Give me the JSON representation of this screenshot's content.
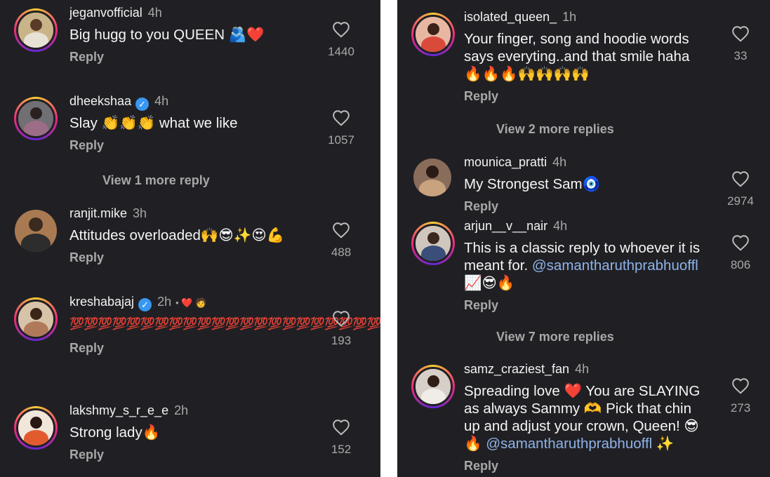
{
  "left": {
    "comments": [
      {
        "user": "jeganvofficial",
        "time": "4h",
        "verified": false,
        "text": "Big hugg to you QUEEN 🫂❤️",
        "reply": "Reply",
        "likes": "1440"
      },
      {
        "user": "dheekshaa",
        "time": "4h",
        "verified": true,
        "text": "Slay 👏👏👏 what we like",
        "reply": "Reply",
        "likes": "1057",
        "more": "View 1 more reply"
      },
      {
        "user": "ranjit.mike",
        "time": "3h",
        "verified": false,
        "text": "Attitudes overloaded🙌😎✨😍💪",
        "reply": "Reply",
        "likes": "488"
      },
      {
        "user": "kreshabajaj",
        "time": "2h",
        "verified": true,
        "liked_by_author": "• ❤️ 🧑",
        "text": "💯💯💯💯💯💯💯💯💯💯💯💯💯💯💯💯💯💯💯💯💯💯",
        "reply": "Reply",
        "likes": "193"
      },
      {
        "user": "lakshmy_s_r_e_e",
        "time": "2h",
        "verified": false,
        "text": "Strong lady🔥",
        "reply": "Reply",
        "likes": "152"
      }
    ]
  },
  "right": {
    "comments": [
      {
        "user": "isolated_queen_",
        "time": "1h",
        "verified": false,
        "text": "Your finger, song and hoodie words says everyting..and that smile haha🔥🔥🔥🙌🙌🙌🙌",
        "reply": "Reply",
        "likes": "33",
        "more": "View 2 more replies"
      },
      {
        "user": "mounica_pratti",
        "time": "4h",
        "verified": false,
        "text": "My Strongest Sam🧿",
        "reply": "Reply",
        "likes": "2974"
      },
      {
        "user": "arjun__v__nair",
        "time": "4h",
        "verified": false,
        "text": "This is a classic reply to whoever it is meant for. ",
        "mention": "@samantharuthprabhuoffl",
        "text_after": " 📈😎🔥",
        "reply": "Reply",
        "likes": "806",
        "more": "View 7 more replies"
      },
      {
        "user": "samz_craziest_fan",
        "time": "4h",
        "verified": false,
        "text": "Spreading love ❤️ You are SLAYING as always Sammy 🫶 Pick that chin up and adjust your crown, Queen! 😎🔥 ",
        "mention": "@samantharuthprabhuoffl",
        "text_after": " ✨",
        "reply": "Reply",
        "likes": "273"
      }
    ]
  },
  "icons": {
    "like": "heart-outline-icon",
    "verified": "verified-badge-icon"
  },
  "colors": {
    "background": "#202024",
    "text": "#f5f5f5",
    "muted": "#a8a8a8",
    "mention": "#8fb3e8",
    "verified": "#3897f0"
  }
}
